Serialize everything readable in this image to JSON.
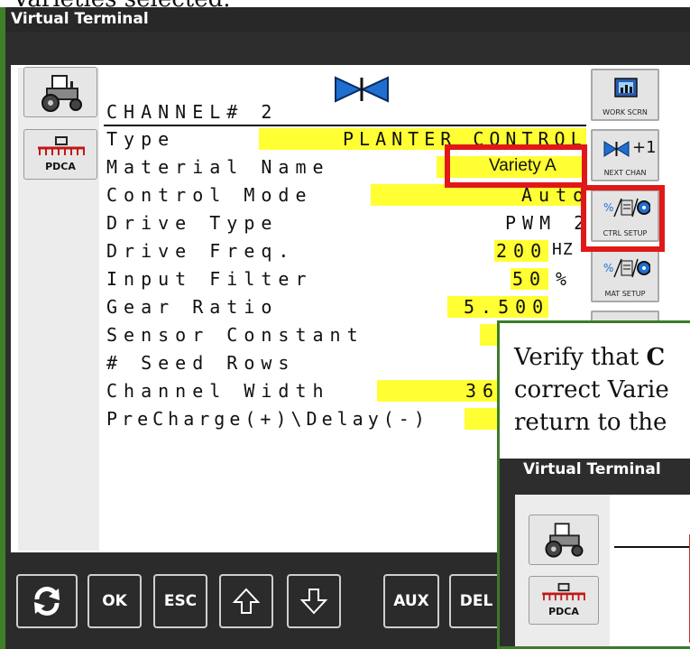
{
  "caption": {
    "top_text": "Varieties selected."
  },
  "window": {
    "title": "Virtual Terminal"
  },
  "left_buttons": [
    {
      "icon": "tractor-icon",
      "label": ""
    },
    {
      "icon": "planter-icon",
      "label": "PDCA"
    }
  ],
  "channel": {
    "title": "CHANNEL# 2",
    "icon": "channel-valve-icon"
  },
  "fields": [
    {
      "label": "Type",
      "value": "PLANTER CONTROL",
      "unit": ""
    },
    {
      "label": "Material Name",
      "value": "Variety A",
      "unit": ""
    },
    {
      "label": "Control Mode",
      "value": "Auto",
      "unit": ""
    },
    {
      "label": "Drive Type",
      "value": "PWM 2",
      "unit": ""
    },
    {
      "label": "Drive Freq.",
      "value": "200",
      "unit": "HZ"
    },
    {
      "label": "Input Filter",
      "value": "50",
      "unit": "%"
    },
    {
      "label": "Gear Ratio",
      "value": "5.500",
      "unit": ""
    },
    {
      "label": "Sensor Constant",
      "value": "",
      "unit": ""
    },
    {
      "label": "# Seed Rows",
      "value": "",
      "unit": ""
    },
    {
      "label": "Channel Width",
      "value": "36",
      "unit": ""
    },
    {
      "label": "PreCharge(+)\\Delay(-)",
      "value": "",
      "unit": ""
    }
  ],
  "right_buttons": [
    {
      "label": "WORK SCRN",
      "icon": "work-screen-icon"
    },
    {
      "label": "NEXT CHAN",
      "icon": "next-channel-icon",
      "badge": "+1"
    },
    {
      "label": "CTRL SETUP",
      "icon": "control-setup-icon"
    },
    {
      "label": "MAT SETUP",
      "icon": "material-setup-icon"
    }
  ],
  "bottom_buttons": [
    {
      "label": "",
      "icon": "refresh-icon"
    },
    {
      "label": "OK"
    },
    {
      "label": "ESC"
    },
    {
      "label": "",
      "icon": "arrow-up-icon"
    },
    {
      "label": "",
      "icon": "arrow-down-icon"
    },
    {
      "label": "AUX"
    },
    {
      "label": "DEL"
    }
  ],
  "overlay": {
    "line1_plain": "Verify that ",
    "line1_bold": "C",
    "line2": "correct Varie",
    "line3": "return to the",
    "mini_title": "Virtual Terminal",
    "mini_button_label": "PDCA"
  },
  "colors": {
    "highlight": "#ffff33",
    "callout_red": "#e11818",
    "callout_green": "#3c7c29"
  }
}
